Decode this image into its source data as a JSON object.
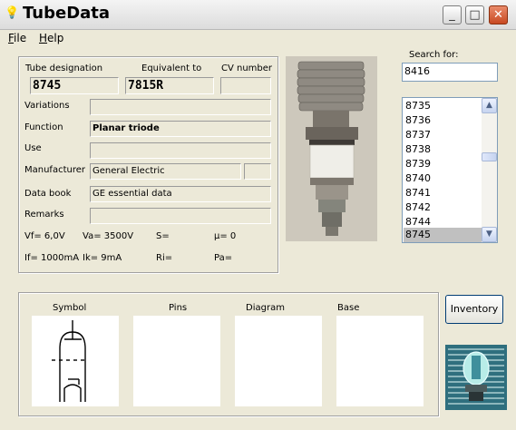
{
  "window": {
    "title": "TubeData",
    "minimize": "_",
    "maximize": "□",
    "close": "✕",
    "app_icon": "bulb-icon"
  },
  "menu": [
    {
      "label": "File",
      "underline": "F",
      "rest": "ile"
    },
    {
      "label": "Help",
      "underline": "H",
      "rest": "elp"
    }
  ],
  "search": {
    "label": "Search for:",
    "value": "8416"
  },
  "list": {
    "items": [
      "8735",
      "8736",
      "8737",
      "8738",
      "8739",
      "8740",
      "8741",
      "8742",
      "8744",
      "8745"
    ],
    "selected": "8745"
  },
  "tube": {
    "designation_label": "Tube designation",
    "designation": "8745",
    "equivalent_label": "Equivalent to",
    "equivalent": "7815R",
    "cv_label": "CV number",
    "cv": "",
    "variations_label": "Variations",
    "variations": "",
    "function_label": "Function",
    "function": "Planar triode",
    "use_label": "Use",
    "use": "",
    "manufacturer_label": "Manufacturer",
    "manufacturer": "General Electric",
    "manufacturer_code": "",
    "databook_label": "Data book",
    "databook": "GE essential data",
    "remarks_label": "Remarks",
    "remarks": ""
  },
  "specs": {
    "vf": "Vf= 6,0V",
    "va": "Va=  3500V",
    "s": "S=",
    "mu": "µ=    0",
    "if": "If= 1000mA",
    "ik": "Ik=   9mA",
    "ri": "Ri=",
    "pa": "Pa="
  },
  "previews": {
    "symbol": "Symbol",
    "pins": "Pins",
    "diagram": "Diagram",
    "base": "Base"
  },
  "inventory_button": "Inventory"
}
